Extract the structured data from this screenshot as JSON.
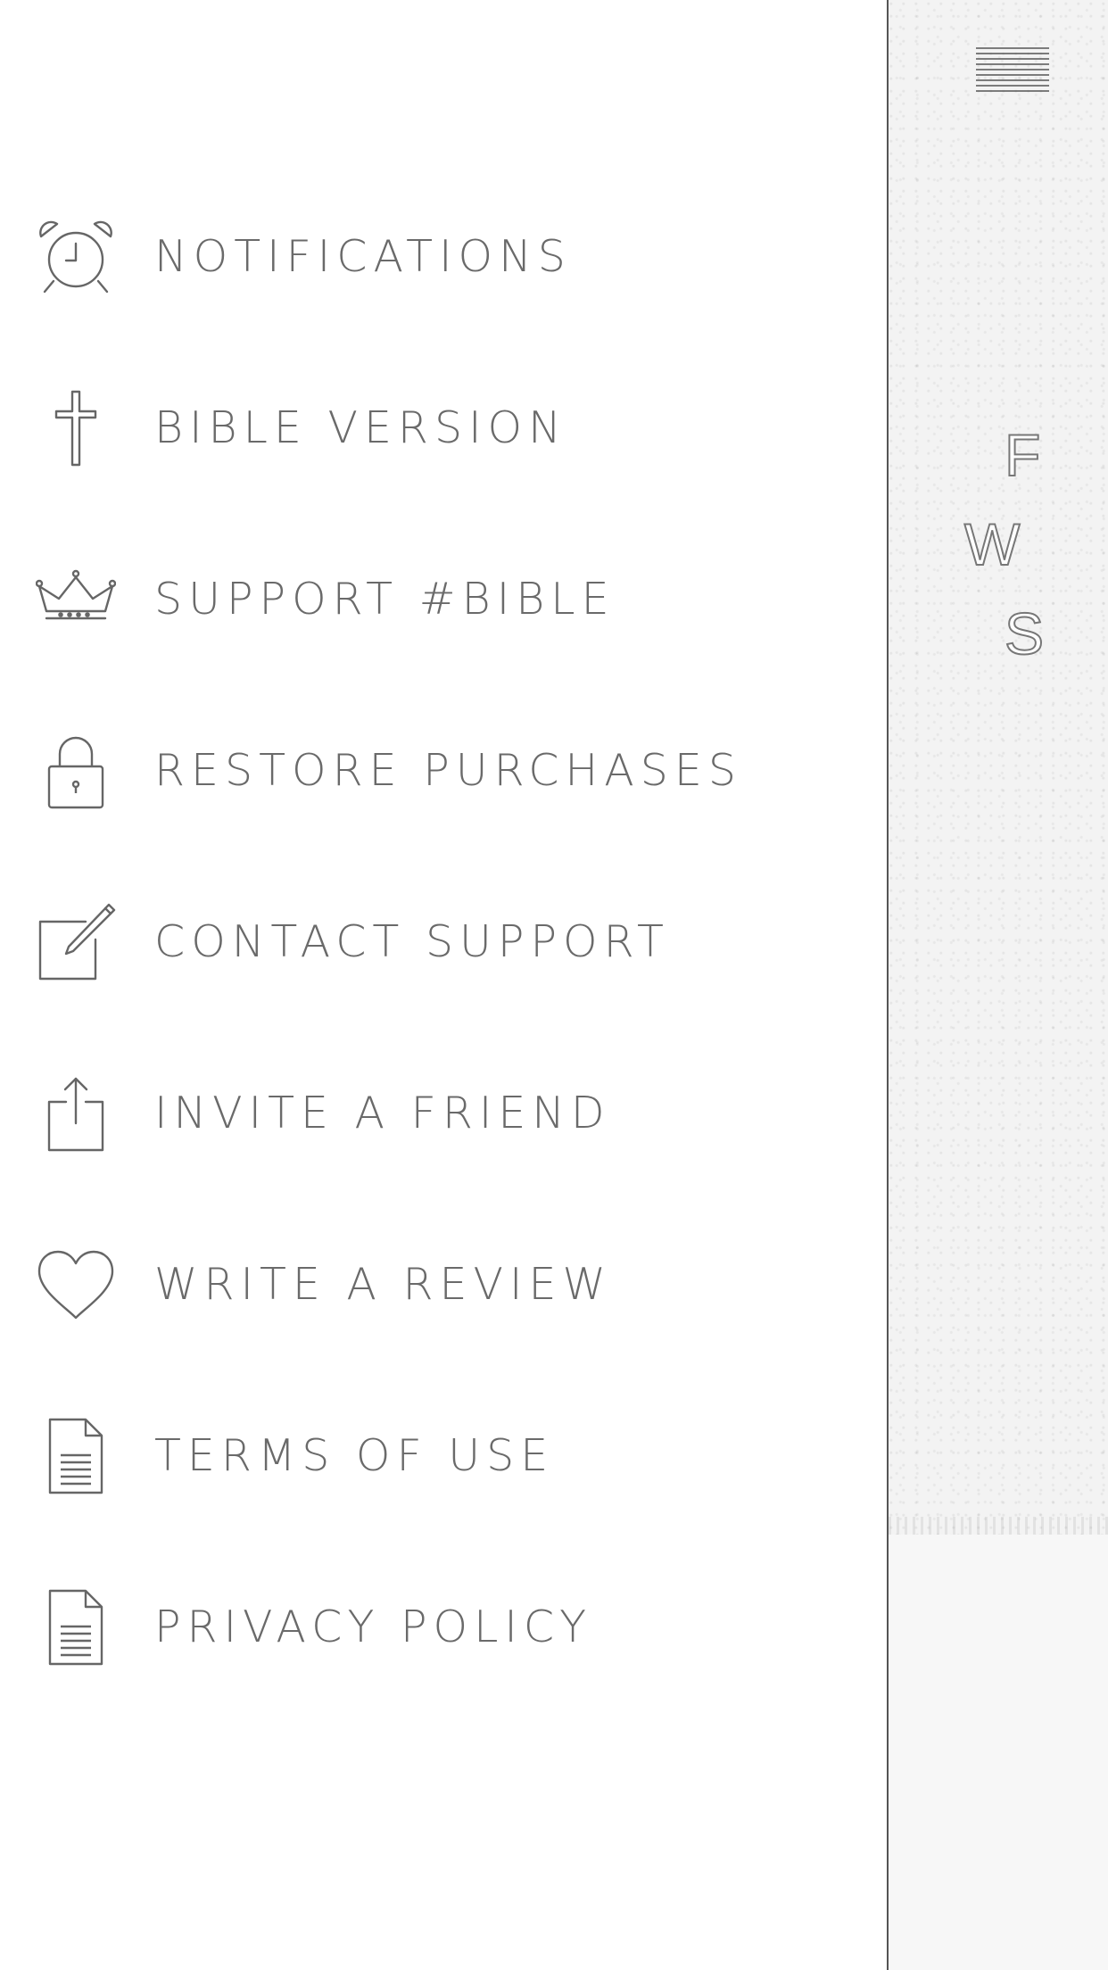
{
  "menu": {
    "items": [
      {
        "label": "NOTIFICATIONS",
        "icon": "alarm-clock-icon"
      },
      {
        "label": "BIBLE VERSION",
        "icon": "cross-icon"
      },
      {
        "label": "SUPPORT #BIBLE",
        "icon": "crown-icon"
      },
      {
        "label": "RESTORE PURCHASES",
        "icon": "padlock-icon"
      },
      {
        "label": "CONTACT SUPPORT",
        "icon": "compose-icon"
      },
      {
        "label": "INVITE A FRIEND",
        "icon": "share-icon"
      },
      {
        "label": "WRITE A REVIEW",
        "icon": "heart-icon"
      },
      {
        "label": "TERMS OF USE",
        "icon": "document-icon"
      },
      {
        "label": "PRIVACY POLICY",
        "icon": "document-icon"
      }
    ]
  },
  "panel": {
    "menu_icon": "hamburger-menu-icon",
    "text_lines": [
      "F",
      "W",
      "S"
    ]
  },
  "colors": {
    "text": "#6a6a6a",
    "icon_stroke": "#666666",
    "panel_border": "#555555",
    "background": "#ffffff"
  }
}
